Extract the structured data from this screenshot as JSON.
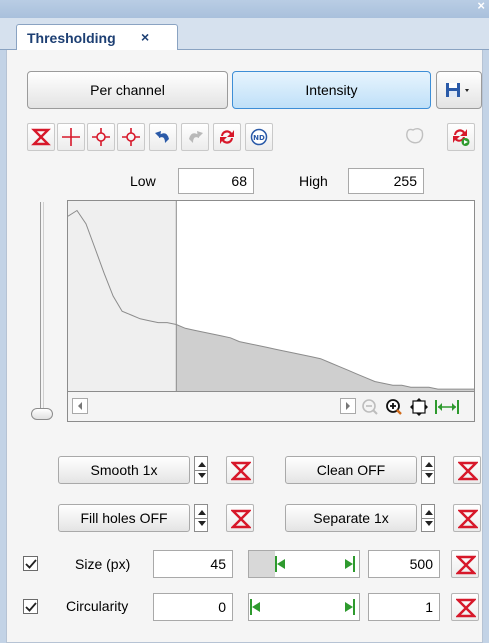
{
  "tab": {
    "title": "Thresholding",
    "close": "×"
  },
  "window_close": "×",
  "modes": {
    "per_channel": "Per channel",
    "intensity": "Intensity",
    "active": "intensity"
  },
  "toolbar": {
    "icons": [
      "reset-threshold-icon",
      "crosshair-icon",
      "pick-min-icon",
      "pick-max-icon",
      "undo-icon",
      "redo-icon",
      "refresh-icon",
      "nd-icon",
      "mask-icon",
      "apply-icon"
    ]
  },
  "threshold": {
    "low_label": "Low",
    "low_value": "68",
    "high_label": "High",
    "high_value": "255",
    "max_value": 255
  },
  "histogram": {
    "fill_color": "#cfcfcf",
    "line_color": "#8c8c8c",
    "profile": [
      0.08,
      0.05,
      0.12,
      0.25,
      0.38,
      0.5,
      0.58,
      0.6,
      0.62,
      0.63,
      0.64,
      0.64,
      0.65,
      0.67,
      0.68,
      0.69,
      0.7,
      0.71,
      0.72,
      0.74,
      0.75,
      0.76,
      0.77,
      0.78,
      0.79,
      0.8,
      0.81,
      0.82,
      0.83,
      0.85,
      0.87,
      0.89,
      0.91,
      0.93,
      0.95,
      0.96,
      0.97,
      0.97,
      0.98,
      0.98,
      0.98,
      0.99,
      0.99,
      0.99,
      0.99,
      0.99
    ]
  },
  "processing": {
    "smooth": "Smooth 1x",
    "clean": "Clean OFF",
    "fill_holes": "Fill holes OFF",
    "separate": "Separate 1x"
  },
  "filters": {
    "size": {
      "label": "Size (px)",
      "min": "45",
      "max": "500",
      "checked": true
    },
    "circularity": {
      "label": "Circularity",
      "min": "0",
      "max": "1",
      "checked": true
    }
  },
  "colors": {
    "accent_red": "#d7182a",
    "accent_green": "#2e9a2e",
    "tab_text": "#1d3f73"
  }
}
